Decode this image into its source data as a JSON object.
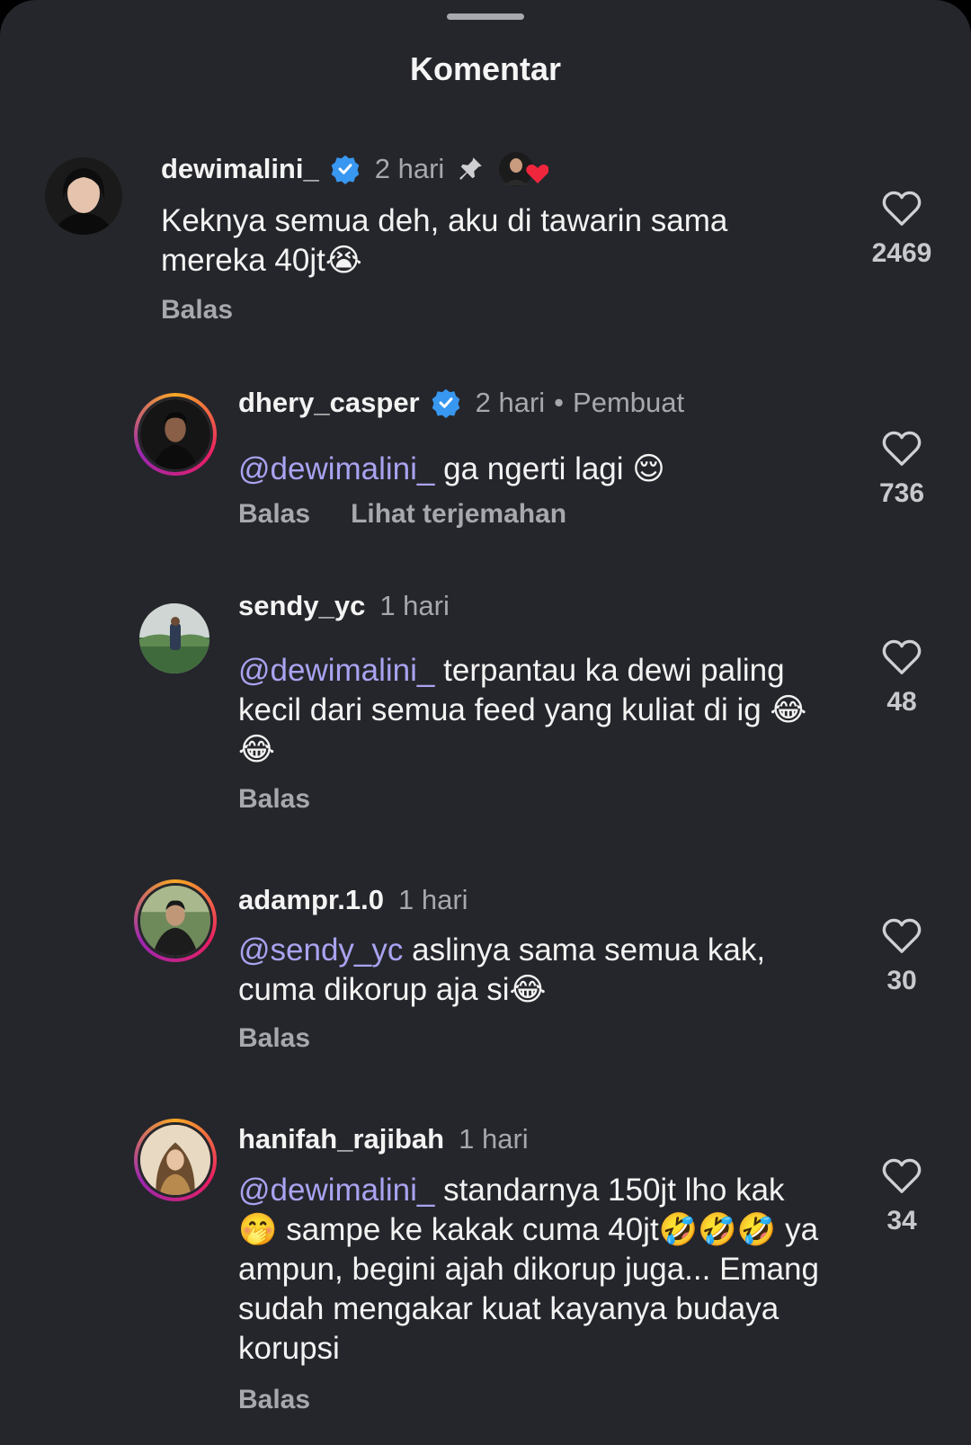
{
  "header": {
    "title": "Komentar"
  },
  "comments": [
    {
      "username": "dewimalini_",
      "time": "2 hari",
      "text_plain": "Keknya semua deh, aku di tawarin sama mereka 40jt😭",
      "actions": [
        "Balas"
      ],
      "likes": "2469"
    },
    {
      "username": "dhery_casper",
      "time": "2 hari",
      "creator": "Pembuat",
      "mention": "@dewimalini_",
      "text": "ga ngerti lagi 😌",
      "actions": [
        "Balas",
        "Lihat terjemahan"
      ],
      "likes": "736"
    },
    {
      "username": "sendy_yc",
      "time": "1 hari",
      "mention": "@dewimalini_",
      "text": "terpantau ka dewi paling kecil dari semua feed yang kuliat di ig 😂😂",
      "actions": [
        "Balas"
      ],
      "likes": "48"
    },
    {
      "username": "adampr.1.0",
      "time": "1 hari",
      "mention": "@sendy_yc",
      "text": "aslinya sama semua kak, cuma dikorup aja si😂",
      "actions": [
        "Balas"
      ],
      "likes": "30"
    },
    {
      "username": "hanifah_rajibah",
      "time": "1 hari",
      "mention": "@dewimalini_",
      "text": "standarnya 150jt lho kak🤭 sampe ke kakak cuma 40jt🤣🤣🤣 ya ampun, begini ajah dikorup juga... Emang sudah mengakar kuat kayanya budaya korupsi",
      "actions": [
        "Balas"
      ],
      "likes": "34"
    }
  ],
  "colors": {
    "background": "#25262b",
    "mention": "#a9a3f1",
    "verified": "#3897f0"
  }
}
